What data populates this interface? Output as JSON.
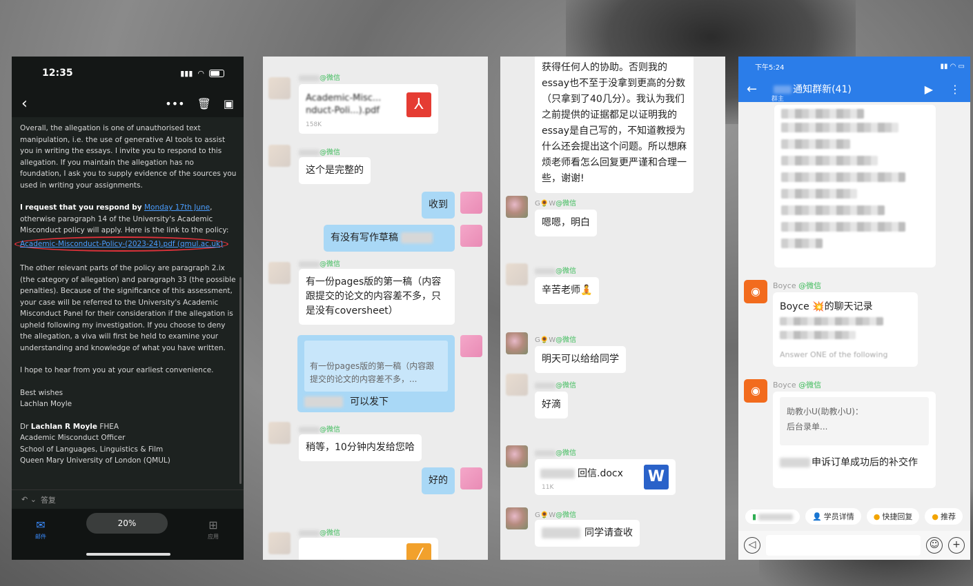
{
  "panel1": {
    "time": "12:35",
    "para1": "Overall, the allegation is one of unauthorised text manipulation, i.e. the use of generative AI tools to assist you in writing the essays. I invite you to respond to this allegation. If you maintain the allegation has no foundation, I ask you to supply evidence of the sources you used in writing your assignments.",
    "para2_bold": "I request that you respond by",
    "para2_date": "Monday 17th June",
    "para2_rest": ", otherwise paragraph 14 of the University's Academic Misconduct policy will apply. Here is the link to the policy:",
    "policy_link": "Academic-Misconduct-Policy-(2023-24).pdf (qmul.ac.uk)",
    "para3": "The other relevant parts of the policy are paragraph 2.ix (the category of allegation) and paragraph 33 (the possible penalties). Because of the significance of this assessment, your case will be referred to the University's Academic Misconduct Panel for their consideration if the allegation is upheld following my investigation. If you choose to deny the allegation, a viva will first be held to examine your understanding and knowledge of what you have written.",
    "para4": "I hope to hear from you at your earliest convenience.",
    "closing1": "Best wishes",
    "closing2": "Lachlan Moyle",
    "sig_prefix": "Dr",
    "sig_name": "Lachlan R Moyle",
    "sig_suffix": "FHEA",
    "sig_role": "Academic Misconduct Officer",
    "sig_school": "School of Languages, Linguistics & Film",
    "sig_uni": "Queen Mary University of London (QMUL)",
    "reply_label": "答复",
    "zoom": "20%",
    "tab_mail": "邮件",
    "tab_apps": "应用"
  },
  "panel2": {
    "wx": "@微信",
    "file1_name": "Academic-Misc...\nnduct-Poli...).pdf",
    "file1_size": "158K",
    "m1": "这个是完整的",
    "m2": "收到",
    "m3": "有没有写作草稿",
    "m4": "有一份pages版的第一稿（内容跟提交的论文的内容差不多，只是没有coversheet）",
    "quote": "有一份pages版的第一稿（内容跟提交的论文的内容差不多，...",
    "m5": "可以发下",
    "m6": "稍等，10分钟内发给您哈",
    "m7": "好的"
  },
  "panel3": {
    "wx": "@微信",
    "m1": "获得任何人的协助。否则我的essay也不至于没拿到更高的分数（只拿到了40几分）。我认为我们之前提供的证据都足以证明我的essay是自己写的，不知道教授为什么还会提出这个问题。所以想麻烦老师看怎么回复更严谨和合理一些，谢谢!",
    "nick_gw": "G🌻W",
    "m2": "嗯嗯，明白",
    "m3": "辛苦老师🧘",
    "m4": "明天可以给给同学",
    "m5": "好滴",
    "file_name": "回信.docx",
    "file_size": "11K",
    "m6": "同学请查收"
  },
  "panel4": {
    "time": "下午5:24",
    "title": "通知群新(41)",
    "sub": "群主",
    "boyce": "Boyce",
    "wx": "@微信",
    "card1_title": "Boyce 💥的聊天记录",
    "card1_line": "Answer ONE of the following",
    "card2_line1": "助教小U(助教小U)：",
    "card2_line2": "后台录单...",
    "card2_main": "申诉订单成功后的补交作",
    "chip1": "学员详情",
    "chip2": "快捷回复",
    "chip3": "推荐"
  }
}
